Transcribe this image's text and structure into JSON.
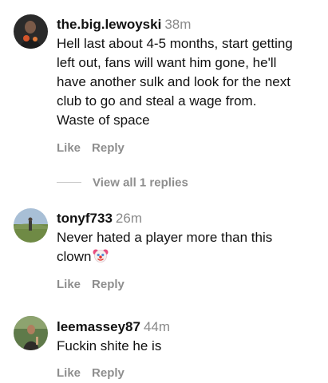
{
  "comments": [
    {
      "username": "the.big.lewoyski",
      "time": "38m",
      "text": "Hell last about 4-5 months, start getting\nleft out, fans will want him gone, he'll\nhave another sulk and look for the next\nclub to go and steal a wage from.\nWaste of space",
      "like_label": "Like",
      "reply_label": "Reply",
      "view_replies": "View all 1 replies"
    },
    {
      "username": "tonyf733",
      "time": "26m",
      "text": "Never hated a player more than this\nclown",
      "emoji": "clown-face-icon",
      "like_label": "Like",
      "reply_label": "Reply"
    },
    {
      "username": "leemassey87",
      "time": "44m",
      "text": "Fuckin shite he is",
      "like_label": "Like",
      "reply_label": "Reply"
    }
  ],
  "colors": {
    "text": "#111111",
    "muted": "#8e8e8e",
    "divider": "#c7c7c7"
  }
}
